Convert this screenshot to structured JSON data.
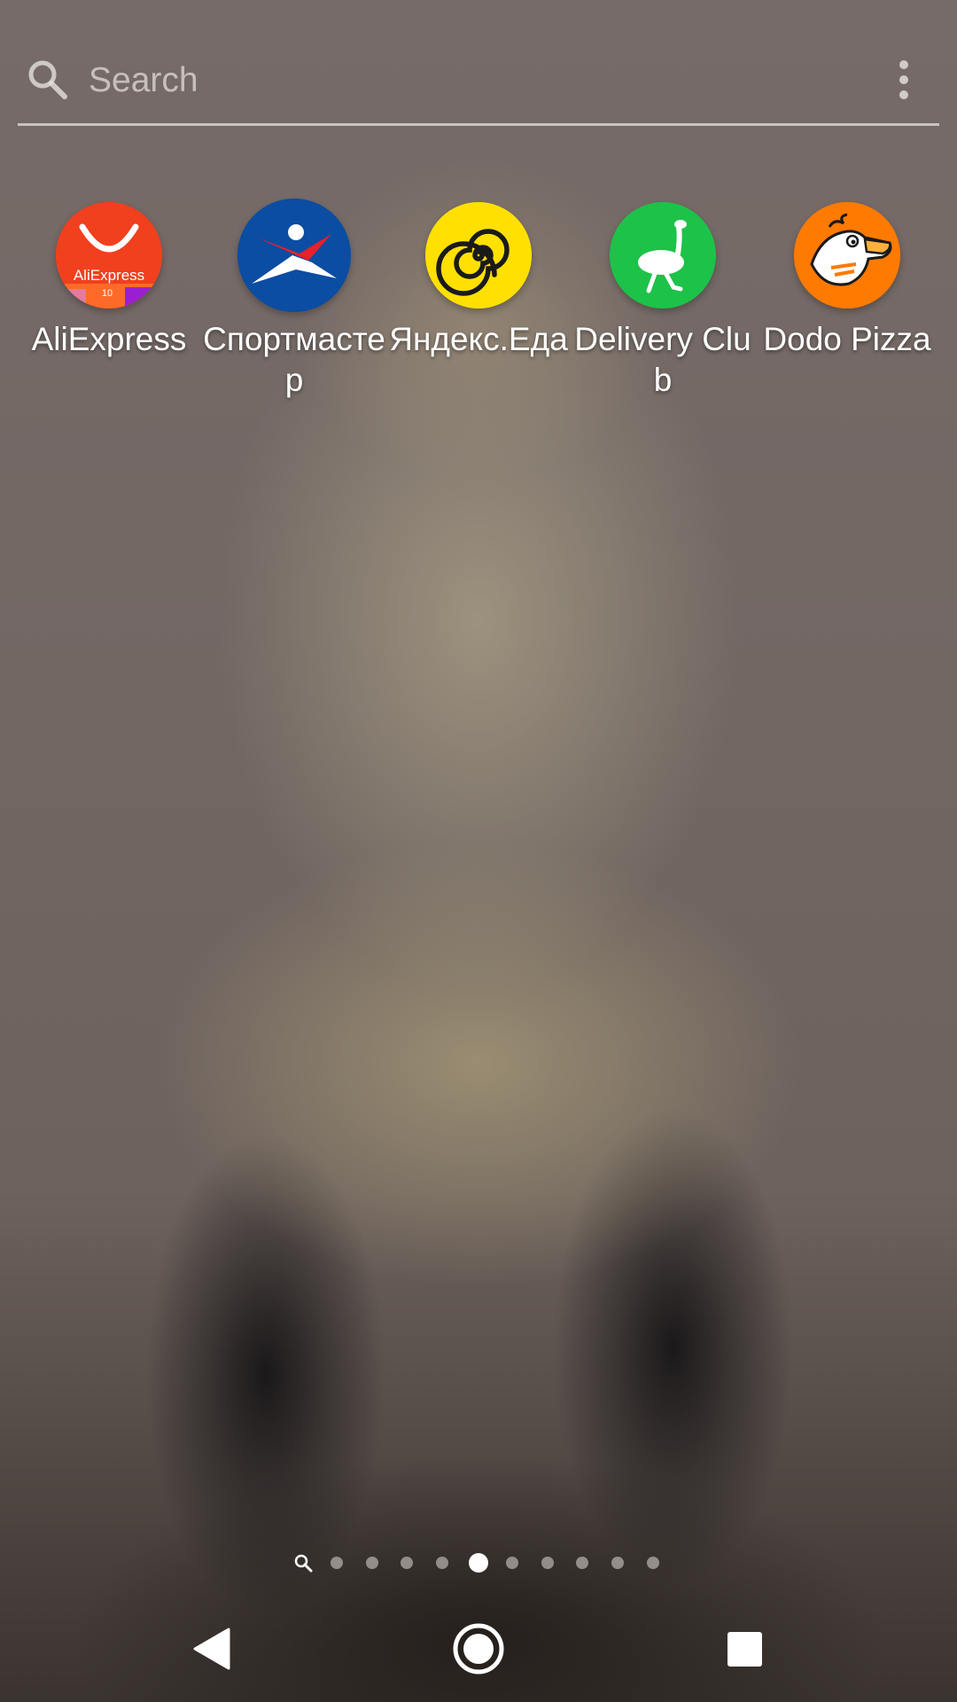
{
  "search": {
    "placeholder": "Search",
    "icon": "search-icon",
    "menu_icon": "more-vert-icon"
  },
  "apps": [
    {
      "label": "AliExpress",
      "icon": "aliexpress-icon",
      "badge_text": "AliExpress",
      "badge_sub": "10",
      "color": "#f23d1e"
    },
    {
      "label": "Спортмастер",
      "icon": "sportmaster-icon",
      "color": "#0a4da2"
    },
    {
      "label": "Яндекс.Еда",
      "icon": "yandex-eda-icon",
      "color": "#ffe000"
    },
    {
      "label": "Delivery Club",
      "icon": "delivery-club-icon",
      "color": "#1dc249"
    },
    {
      "label": "Dodo Pizza",
      "icon": "dodo-pizza-icon",
      "color": "#ff7a00"
    }
  ],
  "page_indicator": {
    "pages": 10,
    "active_page": 5,
    "search_page_icon": "search-icon"
  },
  "nav_bar": {
    "back_icon": "back-triangle-icon",
    "home_icon": "home-circle-icon",
    "recents_icon": "recents-square-icon"
  }
}
